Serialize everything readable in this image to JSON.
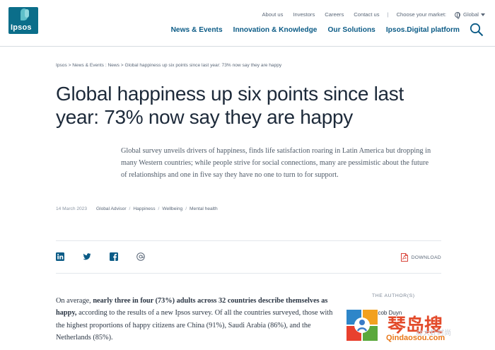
{
  "logo": {
    "text": "Ipsos"
  },
  "utility": {
    "links": [
      "About us",
      "Investors",
      "Careers",
      "Contact us"
    ],
    "separator": "|",
    "market_label": "Choose your market:",
    "market_value": "Global"
  },
  "nav": {
    "items": [
      "News & Events",
      "Innovation & Knowledge",
      "Our Solutions",
      "Ipsos.Digital platform"
    ]
  },
  "breadcrumb": "Ipsos  > News & Events : News  > Global happiness up six points since last year: 73% now say they are happy",
  "article": {
    "title": "Global happiness up six points since last year: 73% now say they are happy",
    "lead": "Global survey unveils drivers of happiness, finds life satisfaction roaring in Latin America but dropping in many Western countries; while people strive for social connections, many are pessimistic about the future of relationships and one in five say they have no one to turn to for support.",
    "date": "14 March 2023",
    "tags": [
      "Global Advisor",
      "Happiness",
      "Wellbeing",
      "Mental health"
    ],
    "download_label": "DOWNLOAD",
    "body_intro": "On average,",
    "body_bold": "nearly three in four (73%) adults across 32 countries describe themselves as happy,",
    "body_rest": "according to the results of a new Ipsos survey. Of all the countries surveyed, those with the highest proportions of happy citizens are China (91%), Saudi Arabia (86%), and the Netherlands (85%)."
  },
  "sidebar": {
    "author_label": "THE AUTHOR(S)",
    "author_name": "Jacob Duyn"
  },
  "watermark": {
    "title": "琴岛搜",
    "sub": "Qindaosou.com",
    "weibo": "@大虾时尚"
  },
  "colors": {
    "brand": "#0b6e8a",
    "nav": "#0b5b86",
    "text": "#1d2a3a",
    "pdf_red": "#d9443a"
  },
  "icons": [
    "search-icon",
    "globe-icon",
    "linkedin-icon",
    "twitter-icon",
    "facebook-icon",
    "email-icon",
    "pdf-icon"
  ]
}
